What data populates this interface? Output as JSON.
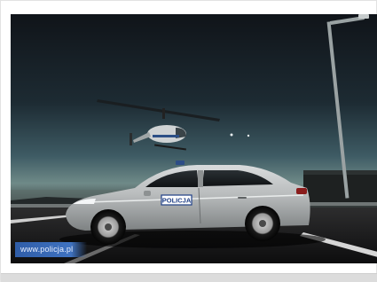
{
  "photo": {
    "car_door_text": "POLICJA",
    "watermark_text": "www.policja.pl"
  }
}
